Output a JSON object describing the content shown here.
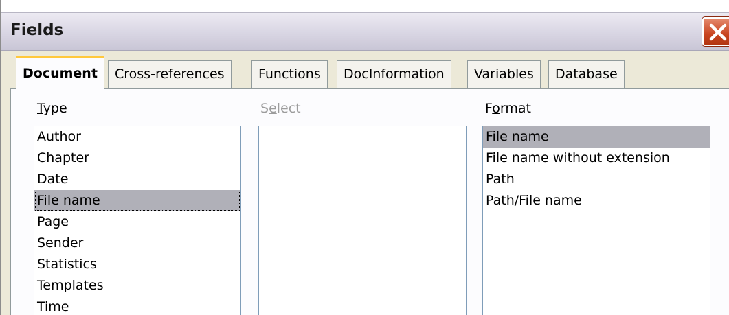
{
  "window": {
    "title": "Fields"
  },
  "tabs": [
    {
      "label": "Document",
      "active": true
    },
    {
      "label": "Cross-references",
      "active": false
    },
    {
      "label": "Functions",
      "active": false
    },
    {
      "label": "DocInformation",
      "active": false
    },
    {
      "label": "Variables",
      "active": false
    },
    {
      "label": "Database",
      "active": false
    }
  ],
  "type": {
    "label_accel": "T",
    "label_rest": "ype",
    "items": [
      "Author",
      "Chapter",
      "Date",
      "File name",
      "Page",
      "Sender",
      "Statistics",
      "Templates",
      "Time"
    ],
    "selected": "File name"
  },
  "select": {
    "label_pre": "S",
    "label_accel": "e",
    "label_rest": "lect",
    "items": []
  },
  "format": {
    "label_pre": "F",
    "label_accel": "o",
    "label_rest": "rmat",
    "items": [
      "File name",
      "File name without extension",
      "Path",
      "Path/File name"
    ],
    "selected": "File name"
  },
  "colors": {
    "selection": "#b0b0b8",
    "active_tab_accent": "#ffc83c",
    "close_button": "#c94521"
  }
}
